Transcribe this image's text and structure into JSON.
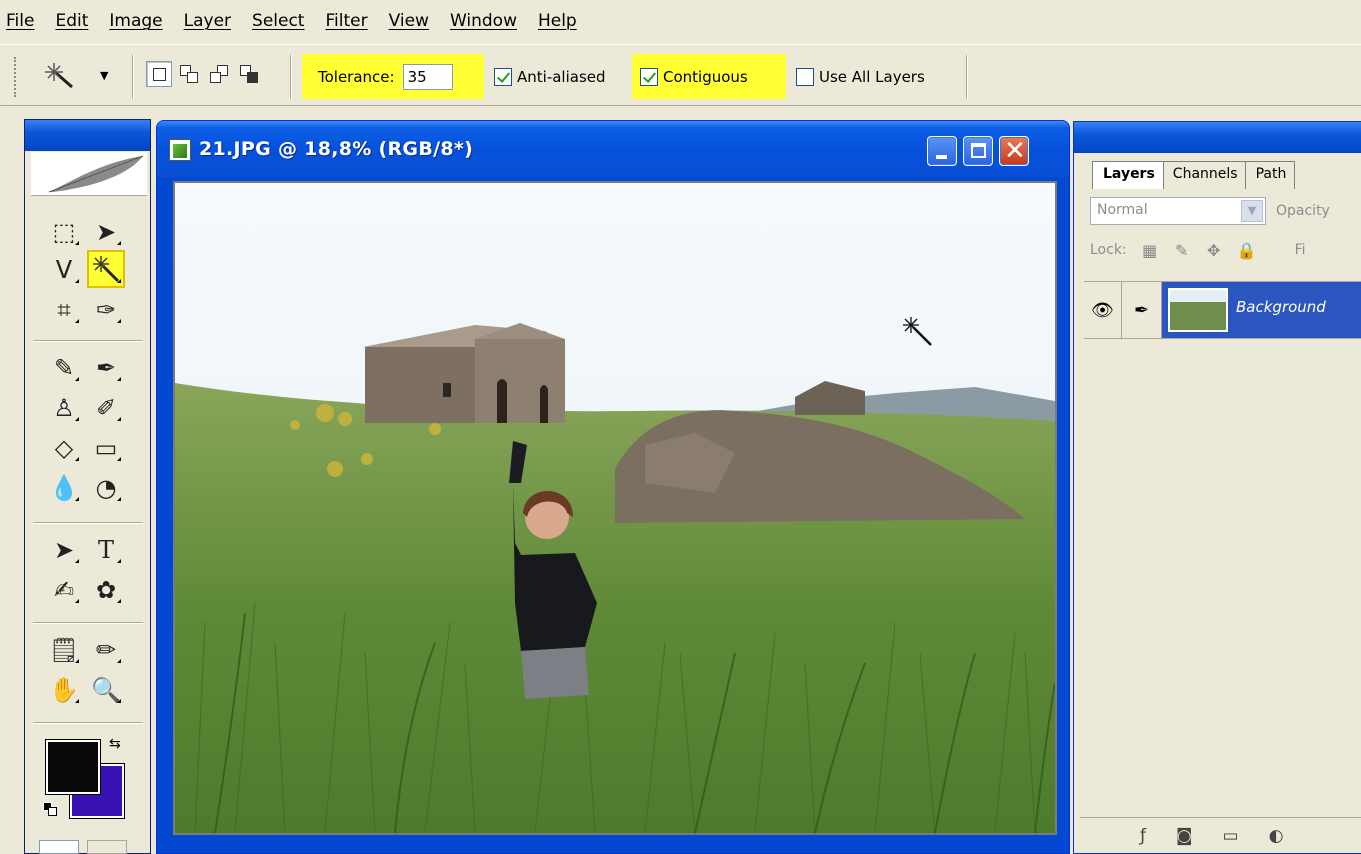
{
  "menu": [
    "File",
    "Edit",
    "Image",
    "Layer",
    "Select",
    "Filter",
    "View",
    "Window",
    "Help"
  ],
  "options": {
    "tolerance_label": "Tolerance:",
    "tolerance_value": "35",
    "anti_aliased_label": "Anti-aliased",
    "anti_aliased_checked": true,
    "contiguous_label": "Contiguous",
    "contiguous_checked": true,
    "use_all_layers_label": "Use All Layers",
    "use_all_layers_checked": false
  },
  "document": {
    "title": "21.JPG @ 18,8% (RGB/8*)"
  },
  "toolbox": {
    "selected_tool": "magic-wand",
    "foreground_color": "#080808",
    "background_color": "#3a11b2"
  },
  "layers_panel": {
    "tabs": [
      "Layers",
      "Channels",
      "Path"
    ],
    "blend_mode": "Normal",
    "opacity_label": "Opacity",
    "lock_label": "Lock:",
    "fill_label": "Fi",
    "layers": [
      {
        "name": "Background",
        "visible": true,
        "selected": true
      }
    ]
  },
  "colors": {
    "highlight": "#ffff33",
    "xp_blue": "#0551dc",
    "layer_selected": "#2b55bf"
  }
}
